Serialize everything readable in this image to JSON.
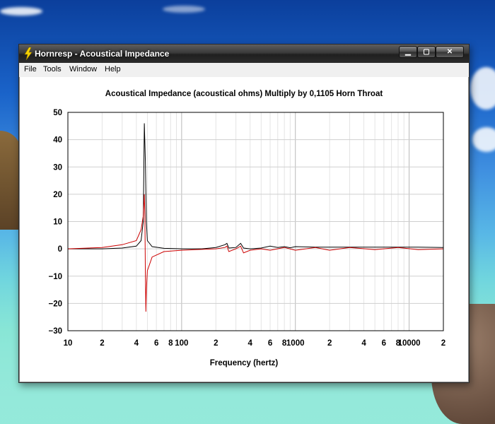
{
  "window": {
    "title": "Hornresp - Acoustical Impedance",
    "buttons": {
      "minimize": "▁",
      "maximize": "▢",
      "close": "✕"
    }
  },
  "menu": {
    "items": [
      "File",
      "Tools",
      "Window",
      "Help"
    ]
  },
  "chart_data": {
    "type": "line",
    "title": "Acoustical Impedance (acoustical ohms)   Multiply by 0,1105   Horn Throat",
    "xlabel": "Frequency (hertz)",
    "ylabel": "",
    "xscale": "log",
    "xlim": [
      10,
      20000
    ],
    "ylim": [
      -30,
      50
    ],
    "yticks": [
      50,
      40,
      30,
      20,
      10,
      0,
      -10,
      -20,
      -30
    ],
    "xtick_labels": [
      {
        "x": 10,
        "label": "10"
      },
      {
        "x": 20,
        "label": "2"
      },
      {
        "x": 40,
        "label": "4"
      },
      {
        "x": 60,
        "label": "6"
      },
      {
        "x": 80,
        "label": "8"
      },
      {
        "x": 100,
        "label": "100"
      },
      {
        "x": 200,
        "label": "2"
      },
      {
        "x": 400,
        "label": "4"
      },
      {
        "x": 600,
        "label": "6"
      },
      {
        "x": 800,
        "label": "8"
      },
      {
        "x": 1000,
        "label": "1000"
      },
      {
        "x": 2000,
        "label": "2"
      },
      {
        "x": 4000,
        "label": "4"
      },
      {
        "x": 6000,
        "label": "6"
      },
      {
        "x": 8000,
        "label": "8"
      },
      {
        "x": 10000,
        "label": "10000"
      },
      {
        "x": 20000,
        "label": "2"
      }
    ],
    "grid": true,
    "series": [
      {
        "color": "#000000",
        "points": [
          [
            10,
            0
          ],
          [
            20,
            0
          ],
          [
            30,
            0.3
          ],
          [
            40,
            1
          ],
          [
            44,
            3
          ],
          [
            46,
            10
          ],
          [
            47,
            46
          ],
          [
            48,
            32
          ],
          [
            49,
            10
          ],
          [
            50,
            3
          ],
          [
            55,
            0.8
          ],
          [
            70,
            0.2
          ],
          [
            100,
            0
          ],
          [
            150,
            0
          ],
          [
            200,
            0.5
          ],
          [
            240,
            1.5
          ],
          [
            250,
            2
          ],
          [
            260,
            0.3
          ],
          [
            300,
            0.5
          ],
          [
            330,
            2
          ],
          [
            350,
            0.3
          ],
          [
            400,
            0
          ],
          [
            500,
            0.3
          ],
          [
            600,
            1
          ],
          [
            700,
            0.5
          ],
          [
            800,
            0.8
          ],
          [
            900,
            0.4
          ],
          [
            1000,
            0.8
          ],
          [
            1500,
            0.6
          ],
          [
            2000,
            0.6
          ],
          [
            3000,
            0.6
          ],
          [
            5000,
            0.6
          ],
          [
            8000,
            0.6
          ],
          [
            12000,
            0.6
          ],
          [
            20000,
            0.5
          ]
        ]
      },
      {
        "color": "#cc0000",
        "points": [
          [
            10,
            0
          ],
          [
            20,
            0.5
          ],
          [
            30,
            1.5
          ],
          [
            40,
            3
          ],
          [
            44,
            7
          ],
          [
            46,
            12
          ],
          [
            47,
            20
          ],
          [
            47.5,
            12
          ],
          [
            48,
            -10
          ],
          [
            48.5,
            -23
          ],
          [
            49,
            -15
          ],
          [
            50,
            -8
          ],
          [
            55,
            -3
          ],
          [
            70,
            -1
          ],
          [
            100,
            -0.5
          ],
          [
            150,
            -0.2
          ],
          [
            200,
            0
          ],
          [
            240,
            0.5
          ],
          [
            250,
            1
          ],
          [
            260,
            -1
          ],
          [
            300,
            0
          ],
          [
            330,
            1
          ],
          [
            350,
            -1.5
          ],
          [
            400,
            -0.5
          ],
          [
            500,
            0
          ],
          [
            600,
            -0.5
          ],
          [
            800,
            0.5
          ],
          [
            1000,
            -0.5
          ],
          [
            1500,
            0.5
          ],
          [
            2000,
            -0.5
          ],
          [
            3000,
            0.5
          ],
          [
            5000,
            -0.3
          ],
          [
            8000,
            0.5
          ],
          [
            12000,
            -0.3
          ],
          [
            20000,
            0
          ]
        ]
      }
    ]
  }
}
